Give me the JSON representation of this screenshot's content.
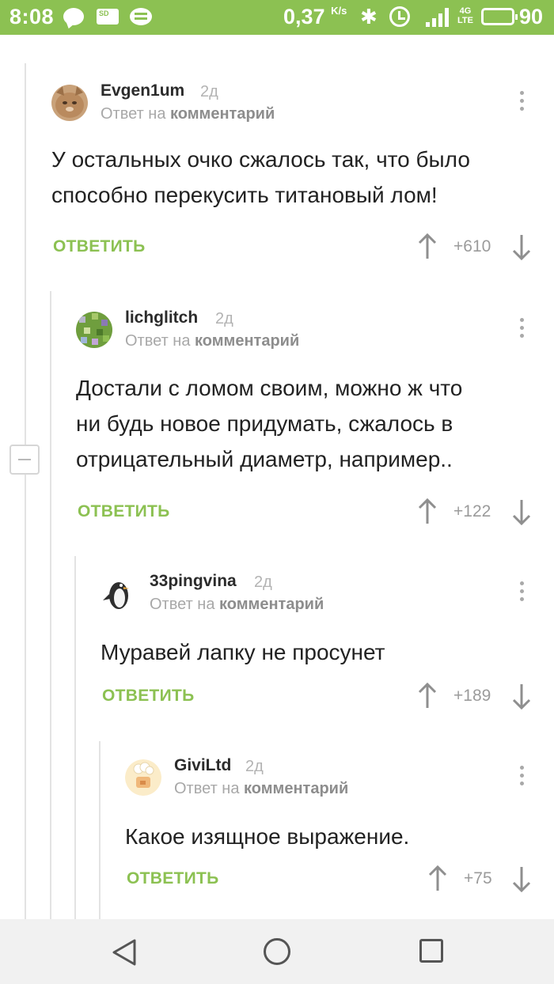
{
  "status_bar": {
    "time": "8:08",
    "sd_label": "SD",
    "speed": "0,37",
    "speed_unit": "K/s",
    "network": "4G",
    "network_sub": "LTE",
    "battery": "90",
    "bluetooth_glyph": "✱",
    "bg_color": "#8cc152"
  },
  "accent_color": "#8cc152",
  "comments": [
    {
      "author": "Evgen1um",
      "age": "2д",
      "reply_prefix": "Ответ на",
      "reply_target": "комментарий",
      "text_lines": [
        "У остальных очко сжалось так, что было",
        "способно перекусить титановый лом!"
      ],
      "reply_label": "ОТВЕТИТЬ",
      "score": "+610",
      "avatar": "cat-avatar"
    },
    {
      "author": "lichglitch",
      "age": "2д",
      "reply_prefix": "Ответ на",
      "reply_target": "комментарий",
      "text_lines": [
        "Достали с ломом своим, можно ж что",
        "ни будь новое придумать, сжалось в",
        "отрицательный диаметр, например.."
      ],
      "reply_label": "ОТВЕТИТЬ",
      "score": "+122",
      "avatar": "pixel-avatar"
    },
    {
      "author": "33pingvina",
      "age": "2д",
      "reply_prefix": "Ответ на",
      "reply_target": "комментарий",
      "text_lines": [
        "Муравей лапку не просунет"
      ],
      "reply_label": "ОТВЕТИТЬ",
      "score": "+189",
      "avatar": "penguin-avatar"
    },
    {
      "author": "GiviLtd",
      "age": "2д",
      "reply_prefix": "Ответ на",
      "reply_target": "комментарий",
      "text_lines": [
        "Какое изящное выражение."
      ],
      "reply_label": "ОТВЕТИТЬ",
      "score": "+75",
      "avatar": "chef-avatar"
    }
  ],
  "nav": {
    "back": "back-icon",
    "home": "home-icon",
    "recents": "recents-icon"
  }
}
